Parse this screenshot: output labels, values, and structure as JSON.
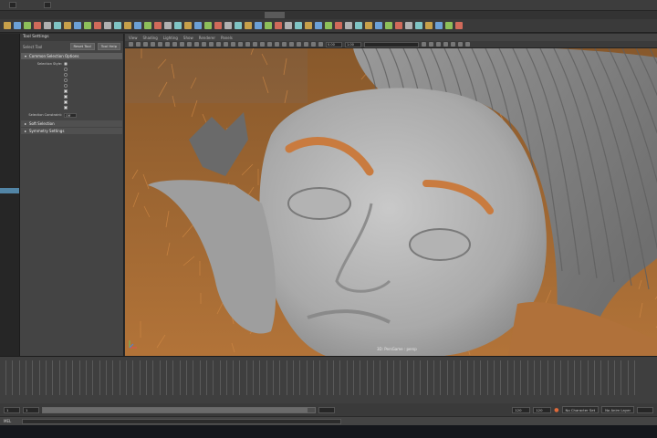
{
  "menubar": {
    "combo_left": "",
    "labels": [
      "",
      "",
      "",
      "",
      ""
    ],
    "combo_right": ""
  },
  "shelf": {
    "tabs": [
      "",
      "",
      "",
      "",
      "",
      "",
      "",
      "",
      "",
      "",
      "",
      "",
      "",
      "",
      "",
      "",
      "",
      "",
      ""
    ],
    "active_tab": 12,
    "icon_colors": [
      "#c7a04a",
      "#6ca0d6",
      "#8dbf5a",
      "#d06a5a",
      "#b0b0b0",
      "#7fc4c4",
      "#c7a04a",
      "#6ca0d6",
      "#8dbf5a",
      "#d06a5a",
      "#b0b0b0",
      "#7fc4c4",
      "#c7a04a",
      "#6ca0d6",
      "#8dbf5a",
      "#d06a5a",
      "#b0b0b0",
      "#7fc4c4",
      "#c7a04a",
      "#6ca0d6",
      "#8dbf5a",
      "#d06a5a",
      "#b0b0b0",
      "#7fc4c4",
      "#c7a04a",
      "#6ca0d6",
      "#8dbf5a",
      "#d06a5a",
      "#b0b0b0",
      "#7fc4c4",
      "#c7a04a",
      "#6ca0d6",
      "#8dbf5a",
      "#d06a5a",
      "#b0b0b0",
      "#7fc4c4",
      "#c7a04a",
      "#6ca0d6",
      "#8dbf5a",
      "#d06a5a",
      "#b0b0b0",
      "#7fc4c4",
      "#c7a04a",
      "#6ca0d6",
      "#8dbf5a",
      "#d06a5a"
    ]
  },
  "outliner": {
    "items": [
      "",
      "",
      "",
      "",
      "",
      "",
      "",
      "",
      "",
      "",
      "",
      "",
      "",
      "",
      "",
      "",
      "",
      "",
      "",
      "",
      "",
      "",
      "",
      "",
      "",
      ""
    ],
    "selected_index": 24
  },
  "tool_settings": {
    "title": "Tool Settings",
    "tool_label": "Select Tool",
    "reset_label": "Reset Tool",
    "help_label": "Tool Help",
    "sections": {
      "common": "Common Selection Options",
      "soft": "Soft Selection",
      "symmetry": "Symmetry Settings"
    },
    "options": [
      {
        "label": "Selection Style:",
        "control": "radio",
        "on": true
      },
      {
        "label": "",
        "control": "radio",
        "on": false
      },
      {
        "label": "",
        "control": "radio",
        "on": false
      },
      {
        "label": "",
        "control": "radio",
        "on": false
      },
      {
        "label": "",
        "control": "radio",
        "on": false
      },
      {
        "label": "",
        "control": "check",
        "on": true
      },
      {
        "label": "",
        "control": "check",
        "on": true
      },
      {
        "label": "",
        "control": "check",
        "on": true
      },
      {
        "label": "",
        "control": "check",
        "on": true
      }
    ],
    "constraint_label": "Selection Constraint:",
    "constraint_value": "Off"
  },
  "viewport": {
    "menu": [
      "View",
      "Shading",
      "Lighting",
      "Show",
      "Renderer",
      "Panels"
    ],
    "field_a": "0.00",
    "field_b": "1.00",
    "color_space": "",
    "camera_label": "3D: PersGame : persp",
    "hud": [
      {
        "key": "",
        "v1": "",
        "v2": ""
      },
      {
        "key": "",
        "v1": "",
        "v2": ""
      },
      {
        "key": "",
        "v1": "",
        "v2": ""
      },
      {
        "key": "",
        "v1": "",
        "v2": ""
      },
      {
        "key": "",
        "v1": "",
        "v2": ""
      }
    ]
  },
  "timeline": {
    "tick_count": 95
  },
  "range": {
    "start": "1",
    "inner_start": "1",
    "inner_end": "",
    "end": "120",
    "end2": "120",
    "character_set": "No Character Set",
    "anim_layer": "No Anim Layer",
    "fps": ""
  },
  "status": {
    "mel": "MEL"
  }
}
